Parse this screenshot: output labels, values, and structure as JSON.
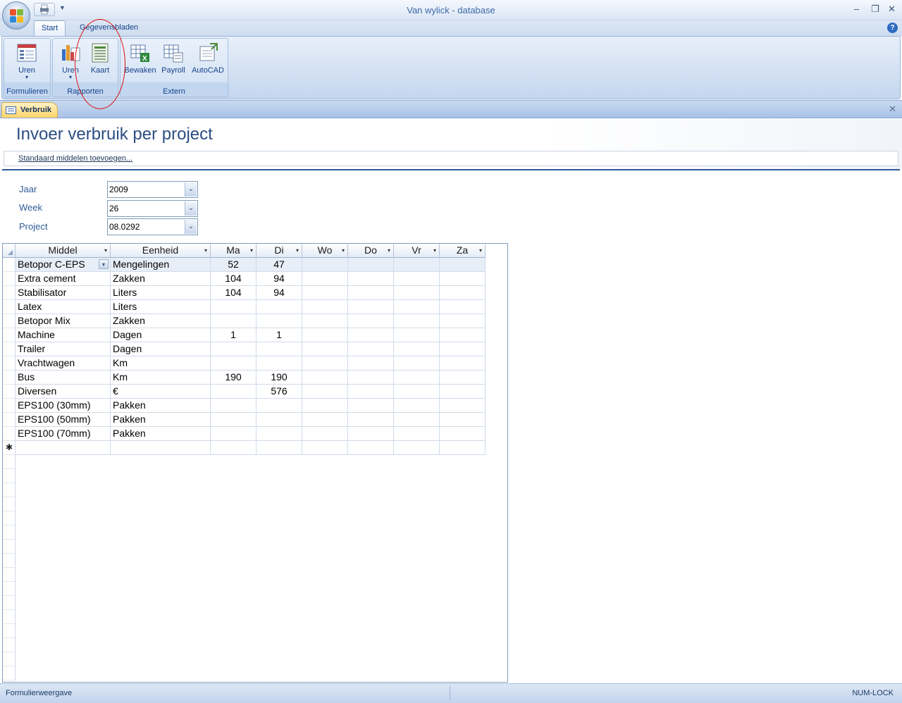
{
  "window": {
    "title": "Van wylick - database",
    "minimize": "‒",
    "restore": "❐",
    "close": "✕"
  },
  "ribbon": {
    "tabs": [
      {
        "label": "Start"
      },
      {
        "label": "Gegevensbladen"
      }
    ],
    "help": "?",
    "groups": {
      "formulieren": {
        "label": "Formulieren",
        "buttons": [
          {
            "label": "Uren"
          }
        ]
      },
      "rapporten": {
        "label": "Rapporten",
        "buttons": [
          {
            "label": "Uren"
          },
          {
            "label": "Kaart"
          }
        ]
      },
      "extern": {
        "label": "Extern",
        "buttons": [
          {
            "label": "Bewaken"
          },
          {
            "label": "Payroll"
          },
          {
            "label": "AutoCAD"
          }
        ]
      }
    },
    "dropdown_arrow": "▾"
  },
  "document": {
    "tab_label": "Verbruik",
    "close": "✕"
  },
  "form": {
    "title": "Invoer verbruik per project",
    "action_link": "Standaard middelen toevoegen...",
    "fields": {
      "jaar": {
        "label": "Jaar",
        "value": "2009"
      },
      "week": {
        "label": "Week",
        "value": "26"
      },
      "project": {
        "label": "Project",
        "value": "08.0292"
      }
    },
    "combo_arrow": "⌄"
  },
  "datasheet": {
    "header_arrow": "▾",
    "new_row_marker": "✱",
    "columns": [
      "Middel",
      "Eenheid",
      "Ma",
      "Di",
      "Wo",
      "Do",
      "Vr",
      "Za"
    ],
    "rows": [
      [
        "Betopor C-EPS",
        "Mengelingen",
        "52",
        "47",
        "",
        "",
        "",
        ""
      ],
      [
        "Extra cement",
        "Zakken",
        "104",
        "94",
        "",
        "",
        "",
        ""
      ],
      [
        "Stabilisator",
        "Liters",
        "104",
        "94",
        "",
        "",
        "",
        ""
      ],
      [
        "Latex",
        "Liters",
        "",
        "",
        "",
        "",
        "",
        ""
      ],
      [
        "Betopor Mix",
        "Zakken",
        "",
        "",
        "",
        "",
        "",
        ""
      ],
      [
        "Machine",
        "Dagen",
        "1",
        "1",
        "",
        "",
        "",
        ""
      ],
      [
        "Trailer",
        "Dagen",
        "",
        "",
        "",
        "",
        "",
        ""
      ],
      [
        "Vrachtwagen",
        "Km",
        "",
        "",
        "",
        "",
        "",
        ""
      ],
      [
        "Bus",
        "Km",
        "190",
        "190",
        "",
        "",
        "",
        ""
      ],
      [
        "Diversen",
        "€",
        "",
        "576",
        "",
        "",
        "",
        ""
      ],
      [
        "EPS100 (30mm)",
        "Pakken",
        "",
        "",
        "",
        "",
        "",
        ""
      ],
      [
        "EPS100 (50mm)",
        "Pakken",
        "",
        "",
        "",
        "",
        "",
        ""
      ],
      [
        "EPS100 (70mm)",
        "Pakken",
        "",
        "",
        "",
        "",
        "",
        ""
      ]
    ]
  },
  "statusbar": {
    "left": "Formulierweergave",
    "right": "NUM-LOCK"
  },
  "colors": {
    "accent": "#15428b",
    "title": "#2b4e83",
    "annotation": "#e01010"
  }
}
